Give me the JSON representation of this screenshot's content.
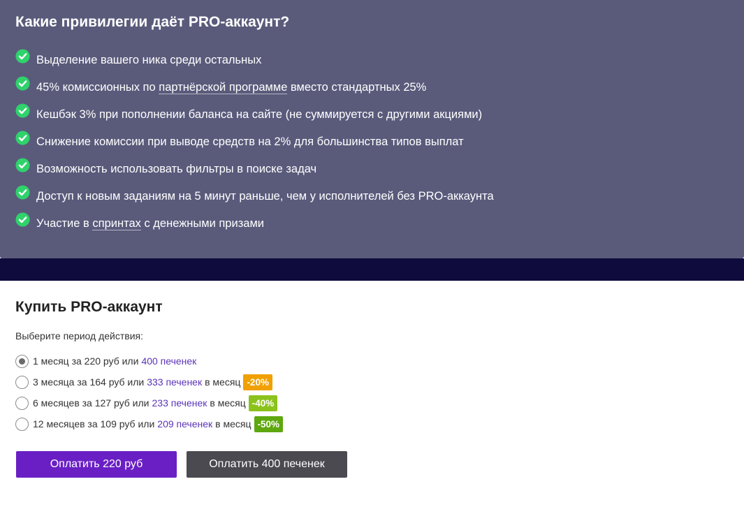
{
  "features": {
    "title": "Какие привилегии даёт PRO-аккаунт?",
    "check_color": "#2fd26b",
    "items": [
      {
        "text": "Выделение вашего ника среди остальных"
      },
      {
        "before": "45% комиссионных по ",
        "link": "партнёрской программе",
        "after": " вместо стандартных 25%"
      },
      {
        "text": "Кешбэк 3% при пополнении баланса на сайте (не суммируется с другими акциями)"
      },
      {
        "text": "Снижение комиссии при выводе средств на 2% для большинства типов выплат"
      },
      {
        "text": "Возможность использовать фильтры в поиске задач"
      },
      {
        "text": "Доступ к новым заданиям на 5 минут раньше, чем у исполнителей без PRO-аккаунта"
      },
      {
        "before": "Участие в ",
        "link": "спринтах",
        "after": " с денежными призами"
      }
    ]
  },
  "buy": {
    "title": "Купить PRO-аккаунт",
    "period_label": "Выберите период действия:",
    "options": [
      {
        "text": "1 месяц за 220 руб или",
        "cookies": "400 печенек",
        "suffix": "",
        "badge": "",
        "badge_color": "",
        "selected": true
      },
      {
        "text": "3 месяца за 164 руб или",
        "cookies": "333 печенек",
        "suffix": "в месяц",
        "badge": "-20%",
        "badge_color": "#f0a000",
        "selected": false
      },
      {
        "text": "6 месяцев за 127 руб или",
        "cookies": "233 печенек",
        "suffix": "в месяц",
        "badge": "-40%",
        "badge_color": "#8cc21c",
        "selected": false
      },
      {
        "text": "12 месяцев за 109 руб или",
        "cookies": "209 печенек",
        "suffix": "в месяц",
        "badge": "-50%",
        "badge_color": "#5ea70e",
        "selected": false
      }
    ],
    "pay_button": "Оплатить 220 руб",
    "cookies_button": "Оплатить 400 печенек"
  }
}
